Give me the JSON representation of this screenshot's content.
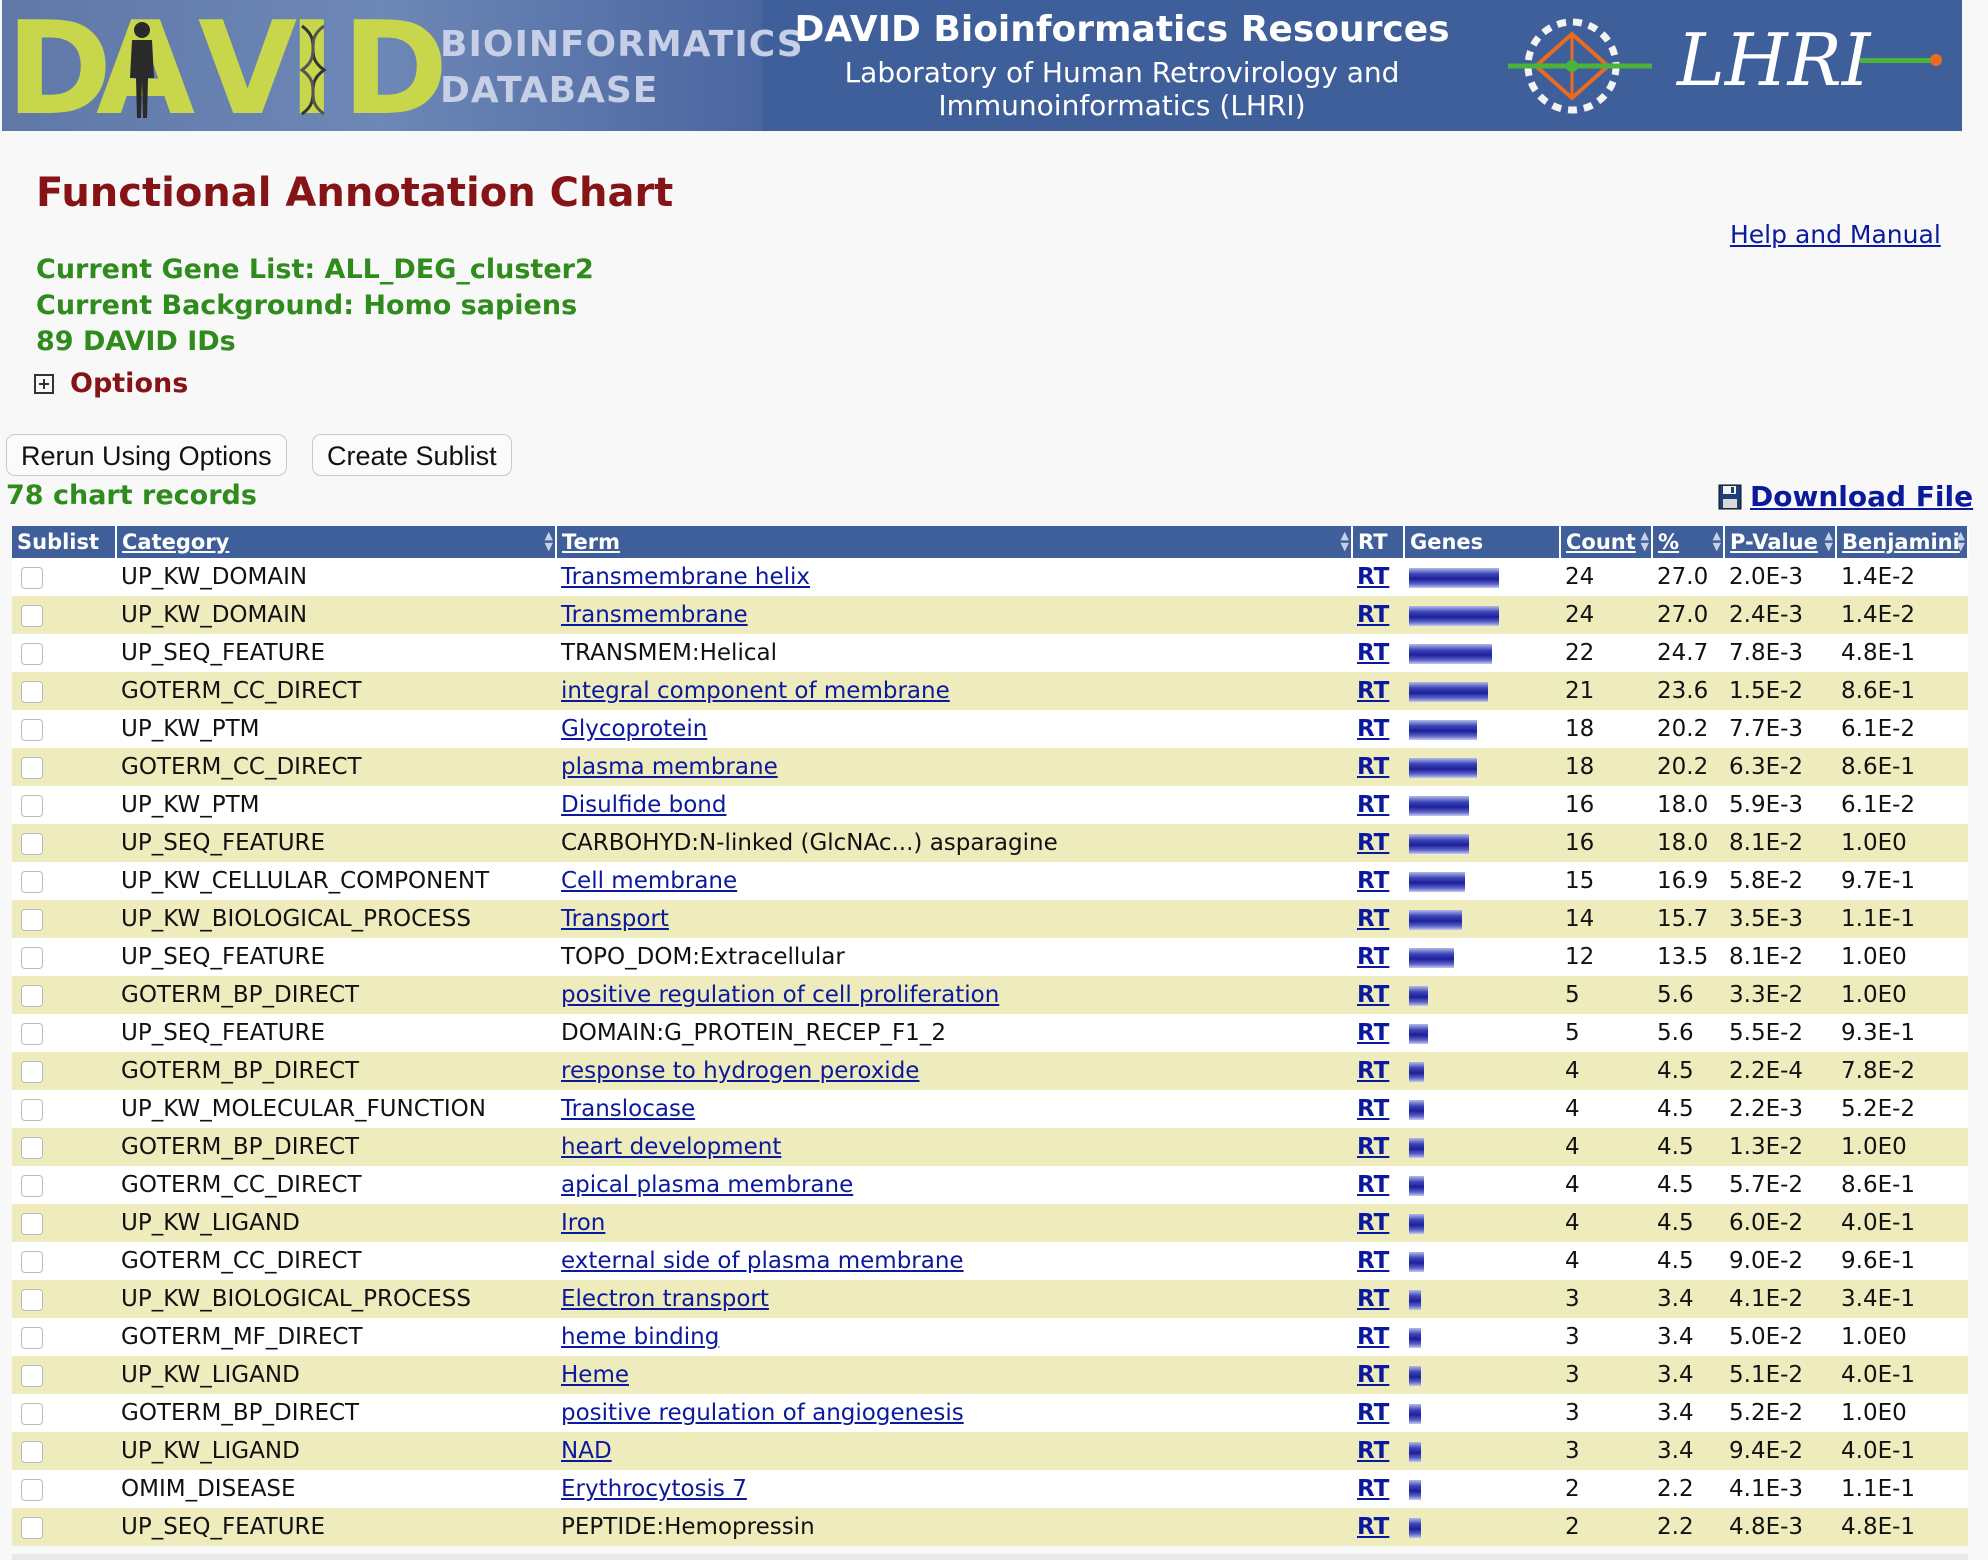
{
  "banner": {
    "logo_text": "DAVID",
    "logo_side_line1": "BIOINFORMATICS",
    "logo_side_line2": "DATABASE",
    "title": "DAVID Bioinformatics Resources",
    "subtitle_line1": "Laboratory of Human Retrovirology and",
    "subtitle_line2": "Immunoinformatics (LHRI)",
    "lhri_text": "LHRI"
  },
  "page": {
    "title": "Functional Annotation Chart",
    "help_link": "Help and Manual",
    "gene_list": "Current Gene List: ALL_DEG_cluster2",
    "background": "Current Background: Homo sapiens",
    "david_ids": "89 DAVID IDs",
    "options_label": "Options",
    "rerun_button": "Rerun Using Options",
    "sublist_button": "Create Sublist",
    "records_count": "78 chart records",
    "download_label": "Download File"
  },
  "table": {
    "headers": {
      "sublist": "Sublist",
      "category": "Category",
      "term": "Term",
      "rt": "RT",
      "genes": "Genes",
      "count": "Count",
      "percent": "%",
      "pvalue": "P-Value",
      "benjamini": "Benjamini"
    },
    "max_count": 24,
    "rows": [
      {
        "category": "UP_KW_DOMAIN",
        "term": "Transmembrane helix",
        "link": true,
        "rt": "RT",
        "count": "24",
        "percent": "27.0",
        "pvalue": "2.0E-3",
        "benjamini": "1.4E-2"
      },
      {
        "category": "UP_KW_DOMAIN",
        "term": "Transmembrane",
        "link": true,
        "rt": "RT",
        "count": "24",
        "percent": "27.0",
        "pvalue": "2.4E-3",
        "benjamini": "1.4E-2"
      },
      {
        "category": "UP_SEQ_FEATURE",
        "term": "TRANSMEM:Helical",
        "link": false,
        "rt": "RT",
        "count": "22",
        "percent": "24.7",
        "pvalue": "7.8E-3",
        "benjamini": "4.8E-1"
      },
      {
        "category": "GOTERM_CC_DIRECT",
        "term": "integral component of membrane",
        "link": true,
        "rt": "RT",
        "count": "21",
        "percent": "23.6",
        "pvalue": "1.5E-2",
        "benjamini": "8.6E-1"
      },
      {
        "category": "UP_KW_PTM",
        "term": "Glycoprotein",
        "link": true,
        "rt": "RT",
        "count": "18",
        "percent": "20.2",
        "pvalue": "7.7E-3",
        "benjamini": "6.1E-2"
      },
      {
        "category": "GOTERM_CC_DIRECT",
        "term": "plasma membrane",
        "link": true,
        "rt": "RT",
        "count": "18",
        "percent": "20.2",
        "pvalue": "6.3E-2",
        "benjamini": "8.6E-1"
      },
      {
        "category": "UP_KW_PTM",
        "term": "Disulfide bond",
        "link": true,
        "rt": "RT",
        "count": "16",
        "percent": "18.0",
        "pvalue": "5.9E-3",
        "benjamini": "6.1E-2"
      },
      {
        "category": "UP_SEQ_FEATURE",
        "term": "CARBOHYD:N-linked (GlcNAc...) asparagine",
        "link": false,
        "rt": "RT",
        "count": "16",
        "percent": "18.0",
        "pvalue": "8.1E-2",
        "benjamini": "1.0E0"
      },
      {
        "category": "UP_KW_CELLULAR_COMPONENT",
        "term": "Cell membrane",
        "link": true,
        "rt": "RT",
        "count": "15",
        "percent": "16.9",
        "pvalue": "5.8E-2",
        "benjamini": "9.7E-1"
      },
      {
        "category": "UP_KW_BIOLOGICAL_PROCESS",
        "term": "Transport",
        "link": true,
        "rt": "RT",
        "count": "14",
        "percent": "15.7",
        "pvalue": "3.5E-3",
        "benjamini": "1.1E-1"
      },
      {
        "category": "UP_SEQ_FEATURE",
        "term": "TOPO_DOM:Extracellular",
        "link": false,
        "rt": "RT",
        "count": "12",
        "percent": "13.5",
        "pvalue": "8.1E-2",
        "benjamini": "1.0E0"
      },
      {
        "category": "GOTERM_BP_DIRECT",
        "term": "positive regulation of cell proliferation",
        "link": true,
        "rt": "RT",
        "count": "5",
        "percent": "5.6",
        "pvalue": "3.3E-2",
        "benjamini": "1.0E0"
      },
      {
        "category": "UP_SEQ_FEATURE",
        "term": "DOMAIN:G_PROTEIN_RECEP_F1_2",
        "link": false,
        "rt": "RT",
        "count": "5",
        "percent": "5.6",
        "pvalue": "5.5E-2",
        "benjamini": "9.3E-1"
      },
      {
        "category": "GOTERM_BP_DIRECT",
        "term": "response to hydrogen peroxide",
        "link": true,
        "rt": "RT",
        "count": "4",
        "percent": "4.5",
        "pvalue": "2.2E-4",
        "benjamini": "7.8E-2"
      },
      {
        "category": "UP_KW_MOLECULAR_FUNCTION",
        "term": "Translocase",
        "link": true,
        "rt": "RT",
        "count": "4",
        "percent": "4.5",
        "pvalue": "2.2E-3",
        "benjamini": "5.2E-2"
      },
      {
        "category": "GOTERM_BP_DIRECT",
        "term": "heart development",
        "link": true,
        "rt": "RT",
        "count": "4",
        "percent": "4.5",
        "pvalue": "1.3E-2",
        "benjamini": "1.0E0"
      },
      {
        "category": "GOTERM_CC_DIRECT",
        "term": "apical plasma membrane",
        "link": true,
        "rt": "RT",
        "count": "4",
        "percent": "4.5",
        "pvalue": "5.7E-2",
        "benjamini": "8.6E-1"
      },
      {
        "category": "UP_KW_LIGAND",
        "term": "Iron",
        "link": true,
        "rt": "RT",
        "count": "4",
        "percent": "4.5",
        "pvalue": "6.0E-2",
        "benjamini": "4.0E-1"
      },
      {
        "category": "GOTERM_CC_DIRECT",
        "term": "external side of plasma membrane",
        "link": true,
        "rt": "RT",
        "count": "4",
        "percent": "4.5",
        "pvalue": "9.0E-2",
        "benjamini": "9.6E-1"
      },
      {
        "category": "UP_KW_BIOLOGICAL_PROCESS",
        "term": "Electron transport",
        "link": true,
        "rt": "RT",
        "count": "3",
        "percent": "3.4",
        "pvalue": "4.1E-2",
        "benjamini": "3.4E-1"
      },
      {
        "category": "GOTERM_MF_DIRECT",
        "term": "heme binding",
        "link": true,
        "rt": "RT",
        "count": "3",
        "percent": "3.4",
        "pvalue": "5.0E-2",
        "benjamini": "1.0E0"
      },
      {
        "category": "UP_KW_LIGAND",
        "term": "Heme",
        "link": true,
        "rt": "RT",
        "count": "3",
        "percent": "3.4",
        "pvalue": "5.1E-2",
        "benjamini": "4.0E-1"
      },
      {
        "category": "GOTERM_BP_DIRECT",
        "term": "positive regulation of angiogenesis",
        "link": true,
        "rt": "RT",
        "count": "3",
        "percent": "3.4",
        "pvalue": "5.2E-2",
        "benjamini": "1.0E0"
      },
      {
        "category": "UP_KW_LIGAND",
        "term": "NAD",
        "link": true,
        "rt": "RT",
        "count": "3",
        "percent": "3.4",
        "pvalue": "9.4E-2",
        "benjamini": "4.0E-1"
      },
      {
        "category": "OMIM_DISEASE",
        "term": "Erythrocytosis 7",
        "link": true,
        "rt": "RT",
        "count": "2",
        "percent": "2.2",
        "pvalue": "4.1E-3",
        "benjamini": "1.1E-1"
      },
      {
        "category": "UP_SEQ_FEATURE",
        "term": "PEPTIDE:Hemopressin",
        "link": false,
        "rt": "RT",
        "count": "2",
        "percent": "2.2",
        "pvalue": "4.8E-3",
        "benjamini": "4.8E-1"
      }
    ]
  },
  "colors": {
    "banner": "#3f5f9b",
    "title_red": "#861316",
    "info_green": "#2e8b1c",
    "link_blue": "#0b1a9c",
    "row_alt": "#eeebbd"
  }
}
